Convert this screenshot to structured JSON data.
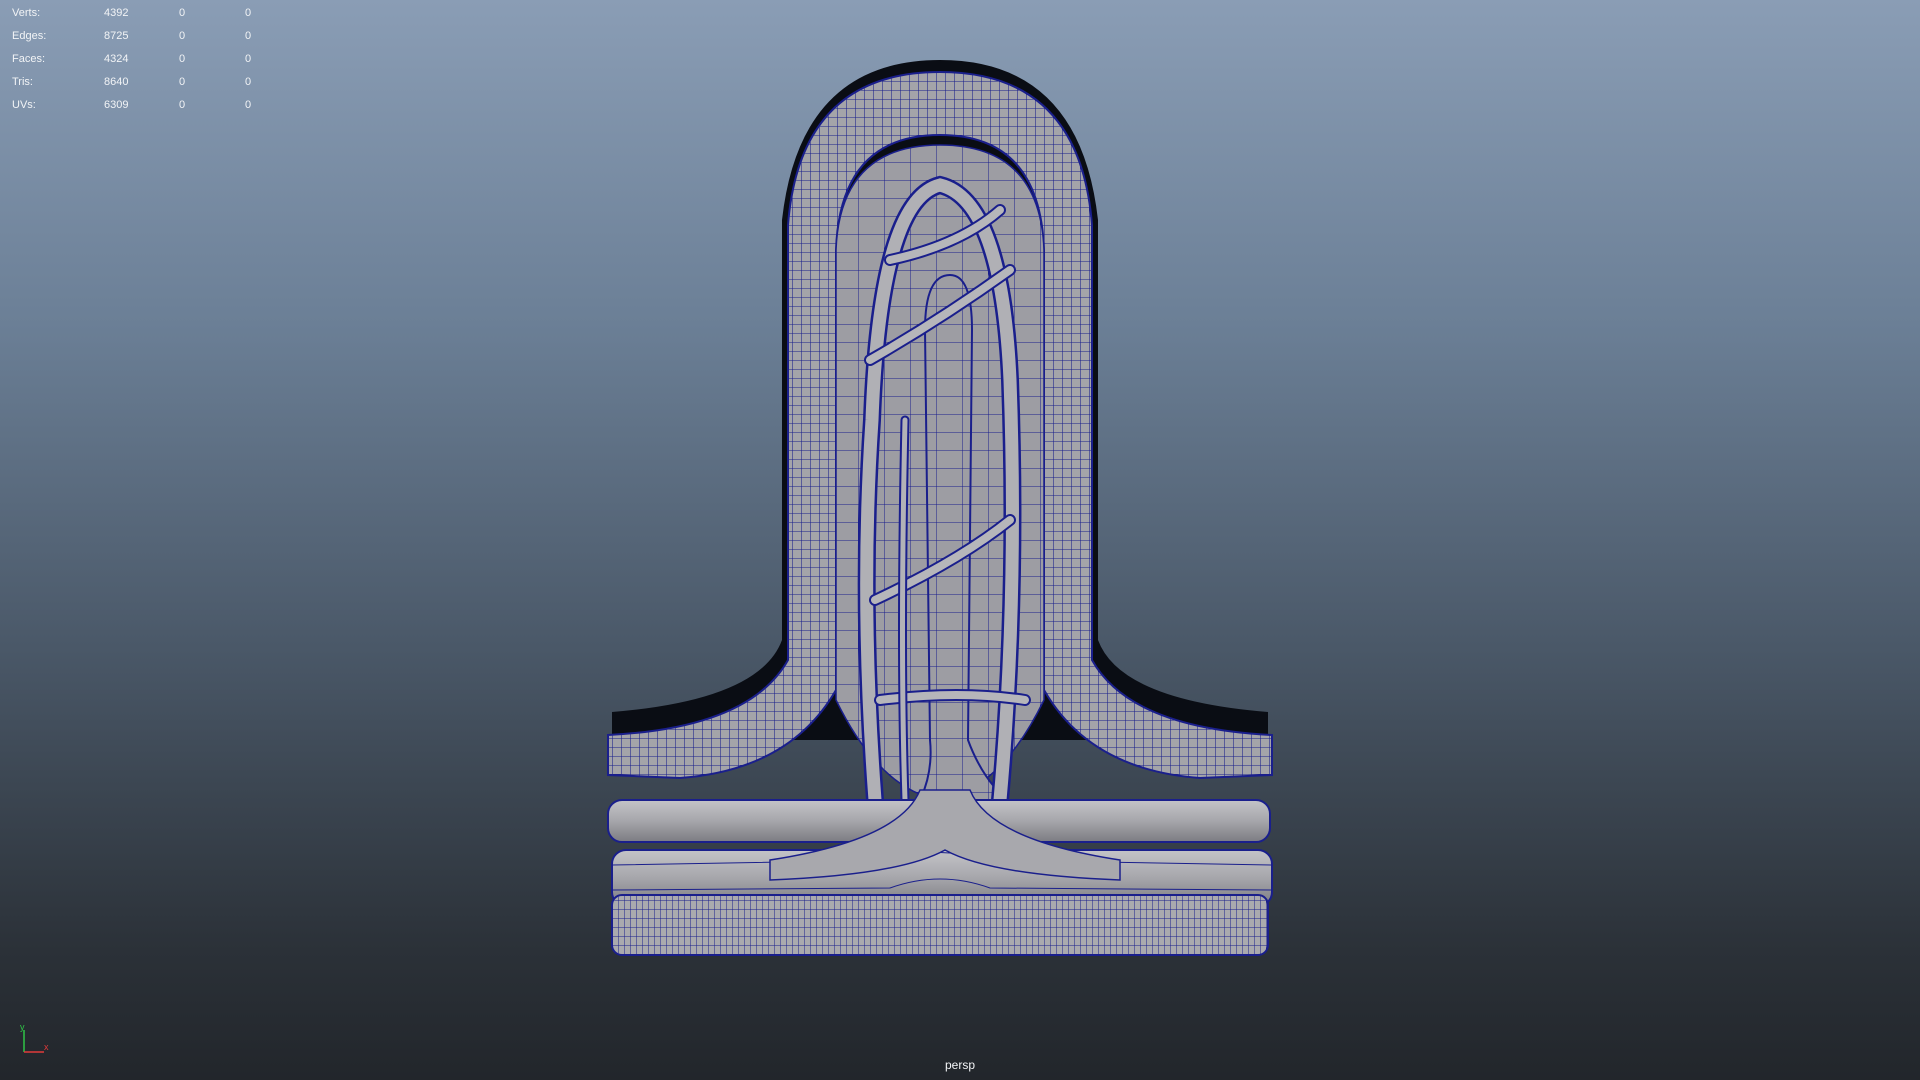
{
  "hud": {
    "rows": [
      {
        "label": "Verts:",
        "values": [
          "4392",
          "0",
          "0"
        ]
      },
      {
        "label": "Edges:",
        "values": [
          "8725",
          "0",
          "0"
        ]
      },
      {
        "label": "Faces:",
        "values": [
          "4324",
          "0",
          "0"
        ]
      },
      {
        "label": "Tris:",
        "values": [
          "8640",
          "0",
          "0"
        ]
      },
      {
        "label": "UVs:",
        "values": [
          "6309",
          "0",
          "0"
        ]
      }
    ]
  },
  "viewport": {
    "camera": "persp",
    "axis_labels": {
      "y": "y",
      "x": "x"
    }
  },
  "colors": {
    "wire": "#1a1f8c",
    "mesh_fill": "#a3a3a8",
    "shadow": "#0a0d14",
    "axis_y": "#2fc447",
    "axis_x": "#e03a3a"
  }
}
